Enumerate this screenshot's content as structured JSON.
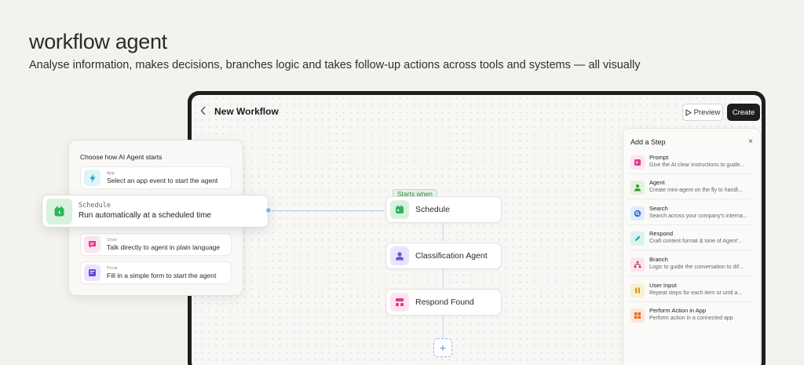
{
  "hero": {
    "title": "workflow agent",
    "subtitle": "Analyse information, makes decisions, branches logic and takes follow-up actions across tools and systems — all visually"
  },
  "builder": {
    "back_icon": "chevron-left-icon",
    "title": "New Workflow",
    "preview_label": "Preview",
    "create_label": "Create",
    "starts_when": "Starts when",
    "nodes": [
      {
        "label": "Schedule",
        "icon": "calendar-icon",
        "color": "#2fb45a"
      },
      {
        "label": "Classification Agent",
        "icon": "person-icon",
        "color": "#6f4fd8"
      },
      {
        "label": "Respond Found",
        "icon": "respond-icon",
        "color": "#e0398c"
      }
    ],
    "add_label": "+"
  },
  "panel": {
    "title": "Add a Step",
    "close": "×",
    "steps": [
      {
        "name": "Prompt",
        "desc": "Give the AI clear instructions to guide...",
        "icon": "prompt-icon",
        "color": "#e0398c",
        "bg": "#fde4ef"
      },
      {
        "name": "Agent",
        "desc": "Create mini-agent on the fly to handl...",
        "icon": "agent-icon",
        "color": "#3e9a3a",
        "bg": "#e3f3df"
      },
      {
        "name": "Search",
        "desc": "Search across your company's interna...",
        "icon": "search-icon",
        "color": "#2d6bd8",
        "bg": "#e0ebfb"
      },
      {
        "name": "Respond",
        "desc": "Craft content format & tone of Agent'...",
        "icon": "pencil-icon",
        "color": "#1aa39a",
        "bg": "#daf3f0"
      },
      {
        "name": "Branch",
        "desc": "Logic to guide the conversation to dif...",
        "icon": "branch-icon",
        "color": "#c0356f",
        "bg": "#fbe3ec"
      },
      {
        "name": "User Input",
        "desc": "Repeat steps for each item or until a...",
        "icon": "pause-icon",
        "color": "#d79a12",
        "bg": "#fbf0d4"
      },
      {
        "name": "Perform Action in App",
        "desc": "Perform action in a connected app",
        "icon": "grid-icon",
        "color": "#e8671f",
        "bg": "#fde6d7"
      }
    ]
  },
  "start_card": {
    "title": "Choose how AI Agent starts",
    "options": [
      {
        "tag": "App",
        "label": "Select an app event to start the agent",
        "icon": "bolt-icon",
        "color": "#1aa3c8",
        "bg": "#dff3f9"
      },
      {
        "tag": "Chat",
        "label": "Talk directly to agent in plain language",
        "icon": "chat-icon",
        "color": "#e0398c",
        "bg": "#fde4ef"
      },
      {
        "tag": "Form",
        "label": "Fill in a simple form to start the agent",
        "icon": "form-icon",
        "color": "#6a46d6",
        "bg": "#ebe4fb"
      }
    ],
    "selected": {
      "tag": "Schedule",
      "label": "Run automatically at a scheduled time",
      "icon": "calendar-icon",
      "color": "#2fb45a"
    }
  }
}
